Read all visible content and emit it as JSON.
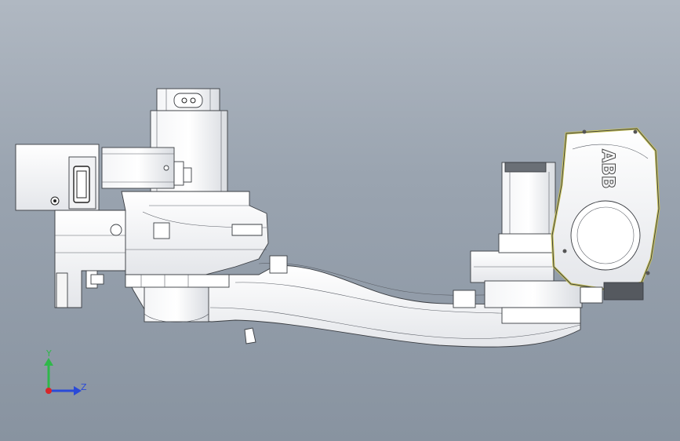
{
  "view": {
    "background_top": "#b0b8c2",
    "background_bottom": "#8893a0",
    "part_fill": "#ffffff",
    "part_shade": "#e6e8ec",
    "edge_color": "#3a3d42",
    "accent_edge": "#c8c25a"
  },
  "triad": {
    "y_label": "Y",
    "z_label": "Z",
    "y_color": "#2fb84a",
    "z_color": "#2a4ad8",
    "x_color": "#d8262a"
  },
  "model": {
    "brand_marking": "ABB"
  }
}
